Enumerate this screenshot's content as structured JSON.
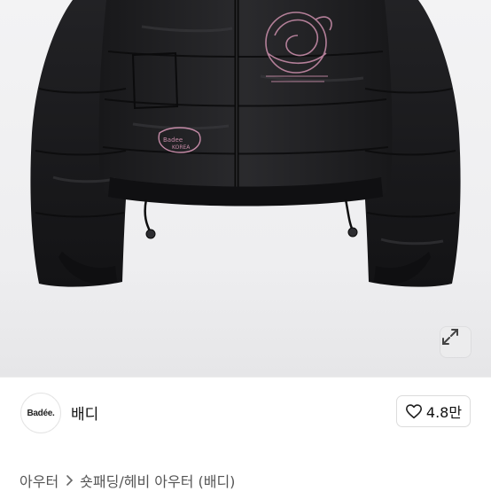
{
  "product_image": {
    "patch_text_1": "Badee",
    "patch_text_2": "KOREA"
  },
  "expand_button": {
    "icon": "expand-icon"
  },
  "seller": {
    "logo_text": "Badée.",
    "name": "배디"
  },
  "like_button": {
    "icon": "heart-icon",
    "count": "4.8만"
  },
  "breadcrumb": {
    "items": [
      "아우터",
      "숏패딩/헤비 아우터 (배디)"
    ],
    "separator_icon": "chevron-right-icon"
  },
  "colors": {
    "jacket": "#1b1b1d",
    "embroidery": "#c48aa6",
    "background": "#f0f0f2"
  }
}
